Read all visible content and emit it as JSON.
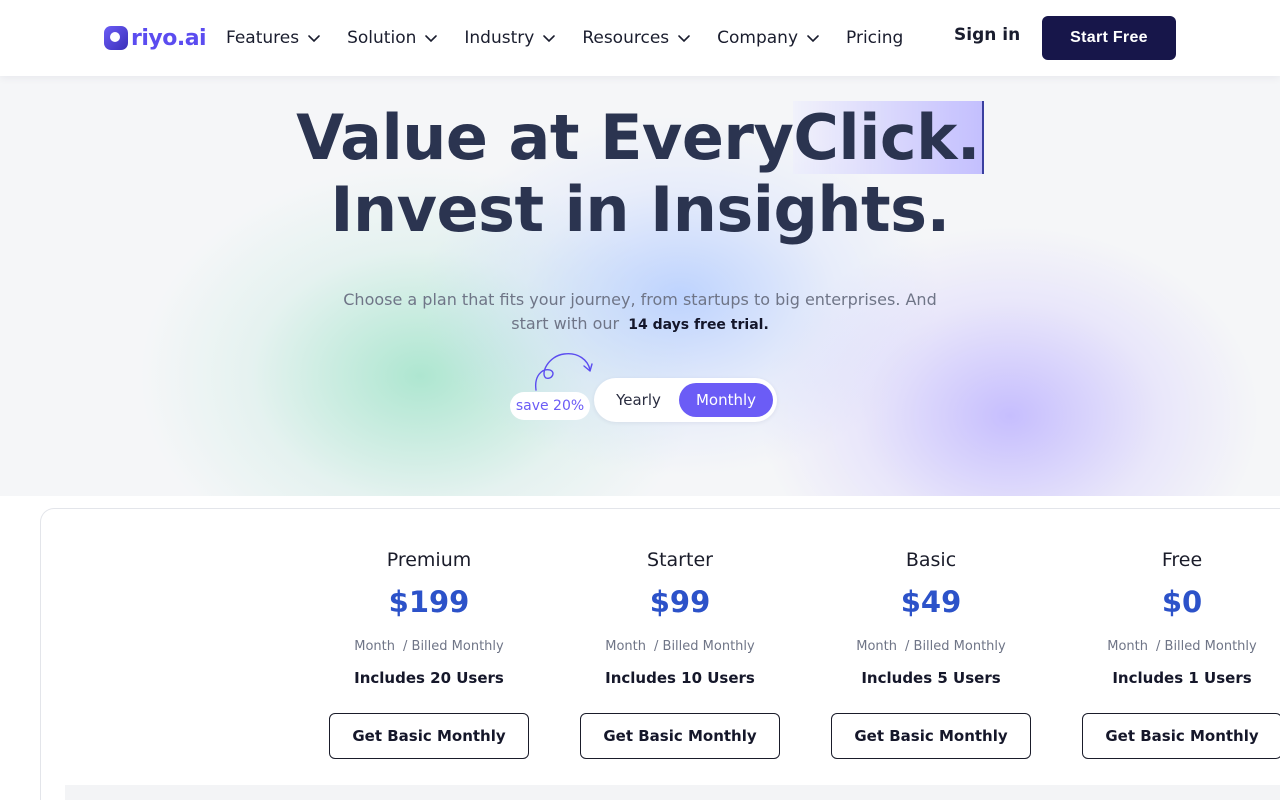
{
  "brand": {
    "name": "riyo.ai"
  },
  "nav": {
    "items": [
      {
        "label": "Features",
        "dropdown": true
      },
      {
        "label": "Solution",
        "dropdown": true
      },
      {
        "label": "Industry",
        "dropdown": true
      },
      {
        "label": "Resources",
        "dropdown": true
      },
      {
        "label": "Company",
        "dropdown": true
      },
      {
        "label": "Pricing",
        "dropdown": false
      }
    ],
    "sign_in": "Sign in",
    "cta": "Start Free"
  },
  "hero": {
    "title_line1_prefix": "Value at Every",
    "title_line1_highlight": "Click.",
    "title_line2": "Invest in Insights.",
    "subtitle": "Choose a plan that fits your journey, from startups to big enterprises. And start with our",
    "subtitle_bold": "14 days free trial.",
    "save_badge": "save 20%",
    "toggle": {
      "yearly": "Yearly",
      "monthly": "Monthly",
      "selected": "Monthly"
    }
  },
  "plans": [
    {
      "name": "Premium",
      "price": "$199",
      "period": "Month",
      "billing": "/ Billed Monthly",
      "users": "Includes 20 Users",
      "button": "Get Basic Monthly"
    },
    {
      "name": "Starter",
      "price": "$99",
      "period": "Month",
      "billing": "/ Billed Monthly",
      "users": "Includes 10 Users",
      "button": "Get Basic Monthly"
    },
    {
      "name": "Basic",
      "price": "$49",
      "period": "Month",
      "billing": "/ Billed Monthly",
      "users": "Includes 5 Users",
      "button": "Get Basic Monthly"
    },
    {
      "name": "Free",
      "price": "$0",
      "period": "Month",
      "billing": "/ Billed Monthly",
      "users": "Includes 1 Users",
      "button": "Get Basic Monthly"
    }
  ],
  "colors": {
    "accent": "#6b5cf6",
    "cta_bg": "#17164a",
    "price": "#2c52c9",
    "title": "#2b3450"
  }
}
